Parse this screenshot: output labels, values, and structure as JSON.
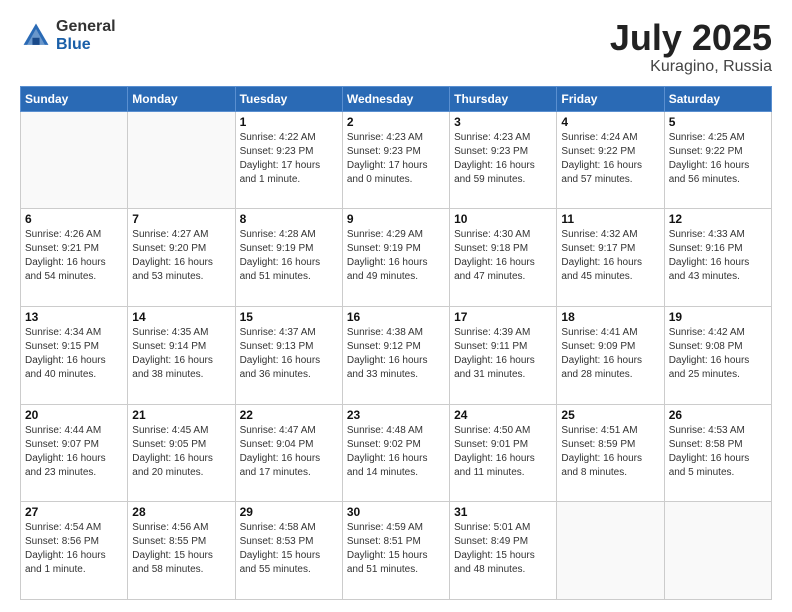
{
  "header": {
    "logo_general": "General",
    "logo_blue": "Blue",
    "title": "July 2025",
    "location": "Kuragino, Russia"
  },
  "days_of_week": [
    "Sunday",
    "Monday",
    "Tuesday",
    "Wednesday",
    "Thursday",
    "Friday",
    "Saturday"
  ],
  "weeks": [
    [
      {
        "day": "",
        "info": ""
      },
      {
        "day": "",
        "info": ""
      },
      {
        "day": "1",
        "sunrise": "Sunrise: 4:22 AM",
        "sunset": "Sunset: 9:23 PM",
        "daylight": "Daylight: 17 hours and 1 minute."
      },
      {
        "day": "2",
        "sunrise": "Sunrise: 4:23 AM",
        "sunset": "Sunset: 9:23 PM",
        "daylight": "Daylight: 17 hours and 0 minutes."
      },
      {
        "day": "3",
        "sunrise": "Sunrise: 4:23 AM",
        "sunset": "Sunset: 9:23 PM",
        "daylight": "Daylight: 16 hours and 59 minutes."
      },
      {
        "day": "4",
        "sunrise": "Sunrise: 4:24 AM",
        "sunset": "Sunset: 9:22 PM",
        "daylight": "Daylight: 16 hours and 57 minutes."
      },
      {
        "day": "5",
        "sunrise": "Sunrise: 4:25 AM",
        "sunset": "Sunset: 9:22 PM",
        "daylight": "Daylight: 16 hours and 56 minutes."
      }
    ],
    [
      {
        "day": "6",
        "sunrise": "Sunrise: 4:26 AM",
        "sunset": "Sunset: 9:21 PM",
        "daylight": "Daylight: 16 hours and 54 minutes."
      },
      {
        "day": "7",
        "sunrise": "Sunrise: 4:27 AM",
        "sunset": "Sunset: 9:20 PM",
        "daylight": "Daylight: 16 hours and 53 minutes."
      },
      {
        "day": "8",
        "sunrise": "Sunrise: 4:28 AM",
        "sunset": "Sunset: 9:19 PM",
        "daylight": "Daylight: 16 hours and 51 minutes."
      },
      {
        "day": "9",
        "sunrise": "Sunrise: 4:29 AM",
        "sunset": "Sunset: 9:19 PM",
        "daylight": "Daylight: 16 hours and 49 minutes."
      },
      {
        "day": "10",
        "sunrise": "Sunrise: 4:30 AM",
        "sunset": "Sunset: 9:18 PM",
        "daylight": "Daylight: 16 hours and 47 minutes."
      },
      {
        "day": "11",
        "sunrise": "Sunrise: 4:32 AM",
        "sunset": "Sunset: 9:17 PM",
        "daylight": "Daylight: 16 hours and 45 minutes."
      },
      {
        "day": "12",
        "sunrise": "Sunrise: 4:33 AM",
        "sunset": "Sunset: 9:16 PM",
        "daylight": "Daylight: 16 hours and 43 minutes."
      }
    ],
    [
      {
        "day": "13",
        "sunrise": "Sunrise: 4:34 AM",
        "sunset": "Sunset: 9:15 PM",
        "daylight": "Daylight: 16 hours and 40 minutes."
      },
      {
        "day": "14",
        "sunrise": "Sunrise: 4:35 AM",
        "sunset": "Sunset: 9:14 PM",
        "daylight": "Daylight: 16 hours and 38 minutes."
      },
      {
        "day": "15",
        "sunrise": "Sunrise: 4:37 AM",
        "sunset": "Sunset: 9:13 PM",
        "daylight": "Daylight: 16 hours and 36 minutes."
      },
      {
        "day": "16",
        "sunrise": "Sunrise: 4:38 AM",
        "sunset": "Sunset: 9:12 PM",
        "daylight": "Daylight: 16 hours and 33 minutes."
      },
      {
        "day": "17",
        "sunrise": "Sunrise: 4:39 AM",
        "sunset": "Sunset: 9:11 PM",
        "daylight": "Daylight: 16 hours and 31 minutes."
      },
      {
        "day": "18",
        "sunrise": "Sunrise: 4:41 AM",
        "sunset": "Sunset: 9:09 PM",
        "daylight": "Daylight: 16 hours and 28 minutes."
      },
      {
        "day": "19",
        "sunrise": "Sunrise: 4:42 AM",
        "sunset": "Sunset: 9:08 PM",
        "daylight": "Daylight: 16 hours and 25 minutes."
      }
    ],
    [
      {
        "day": "20",
        "sunrise": "Sunrise: 4:44 AM",
        "sunset": "Sunset: 9:07 PM",
        "daylight": "Daylight: 16 hours and 23 minutes."
      },
      {
        "day": "21",
        "sunrise": "Sunrise: 4:45 AM",
        "sunset": "Sunset: 9:05 PM",
        "daylight": "Daylight: 16 hours and 20 minutes."
      },
      {
        "day": "22",
        "sunrise": "Sunrise: 4:47 AM",
        "sunset": "Sunset: 9:04 PM",
        "daylight": "Daylight: 16 hours and 17 minutes."
      },
      {
        "day": "23",
        "sunrise": "Sunrise: 4:48 AM",
        "sunset": "Sunset: 9:02 PM",
        "daylight": "Daylight: 16 hours and 14 minutes."
      },
      {
        "day": "24",
        "sunrise": "Sunrise: 4:50 AM",
        "sunset": "Sunset: 9:01 PM",
        "daylight": "Daylight: 16 hours and 11 minutes."
      },
      {
        "day": "25",
        "sunrise": "Sunrise: 4:51 AM",
        "sunset": "Sunset: 8:59 PM",
        "daylight": "Daylight: 16 hours and 8 minutes."
      },
      {
        "day": "26",
        "sunrise": "Sunrise: 4:53 AM",
        "sunset": "Sunset: 8:58 PM",
        "daylight": "Daylight: 16 hours and 5 minutes."
      }
    ],
    [
      {
        "day": "27",
        "sunrise": "Sunrise: 4:54 AM",
        "sunset": "Sunset: 8:56 PM",
        "daylight": "Daylight: 16 hours and 1 minute."
      },
      {
        "day": "28",
        "sunrise": "Sunrise: 4:56 AM",
        "sunset": "Sunset: 8:55 PM",
        "daylight": "Daylight: 15 hours and 58 minutes."
      },
      {
        "day": "29",
        "sunrise": "Sunrise: 4:58 AM",
        "sunset": "Sunset: 8:53 PM",
        "daylight": "Daylight: 15 hours and 55 minutes."
      },
      {
        "day": "30",
        "sunrise": "Sunrise: 4:59 AM",
        "sunset": "Sunset: 8:51 PM",
        "daylight": "Daylight: 15 hours and 51 minutes."
      },
      {
        "day": "31",
        "sunrise": "Sunrise: 5:01 AM",
        "sunset": "Sunset: 8:49 PM",
        "daylight": "Daylight: 15 hours and 48 minutes."
      },
      {
        "day": "",
        "info": ""
      },
      {
        "day": "",
        "info": ""
      }
    ]
  ]
}
